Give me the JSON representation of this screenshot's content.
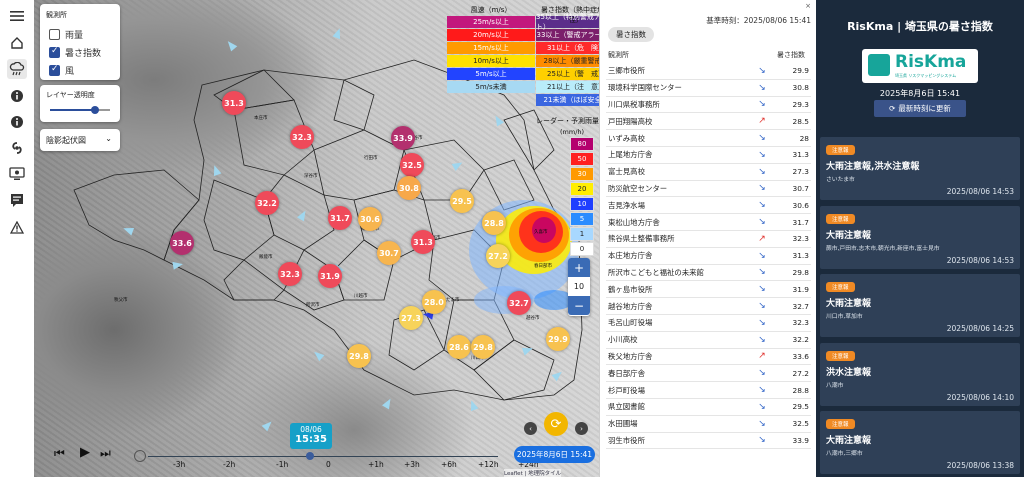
{
  "left_toolbar": [
    {
      "icon": "menu-icon"
    },
    {
      "icon": "home-icon"
    },
    {
      "icon": "rain-cloud-icon"
    },
    {
      "icon": "info-icon"
    },
    {
      "icon": "info-icon"
    },
    {
      "icon": "typhoon-icon"
    },
    {
      "icon": "monitor-icon"
    },
    {
      "icon": "bulletin-icon"
    },
    {
      "icon": "warning-icon"
    }
  ],
  "layers": {
    "title": "観測所",
    "items": [
      {
        "label": "雨量",
        "checked": false
      },
      {
        "label": "暑さ指数",
        "checked": true
      },
      {
        "label": "風",
        "checked": true
      }
    ]
  },
  "opacity": {
    "label": "レイヤー透明度",
    "value": 0.75
  },
  "basemap": {
    "selected": "陰影起伏図"
  },
  "legend_wind": {
    "title": "風速（m/s）",
    "rows": [
      {
        "label": "25m/s以上",
        "color": "#c2187d"
      },
      {
        "label": "20m/s以上",
        "color": "#ff1a1a"
      },
      {
        "label": "15m/s以上",
        "color": "#ff9a00"
      },
      {
        "label": "10m/s以上",
        "color": "#ffe100"
      },
      {
        "label": "5m/s以上",
        "color": "#2244ff"
      },
      {
        "label": "5m/s未満",
        "color": "#a7d9f3"
      }
    ]
  },
  "legend_wbgt": {
    "title": "暑さ指数（熱中症危険性）",
    "rows": [
      {
        "label": "35以上（特別警戒アラート）",
        "color": "#5b2d8a"
      },
      {
        "label": "33以上（警戒アラート）",
        "color": "#7b1f6b"
      },
      {
        "label": "31以上（危　険）",
        "color": "#ff2a2a"
      },
      {
        "label": "28以上（厳重警戒）",
        "color": "#ff8c00"
      },
      {
        "label": "25以上（警　戒）",
        "color": "#ffd000"
      },
      {
        "label": "21以上（注　意）",
        "color": "#b9ecfa"
      },
      {
        "label": "21未満（ほぼ安全）",
        "color": "#3a66e0"
      }
    ]
  },
  "legend_rain": {
    "title": "レーダー・予測雨量",
    "unit": "(mm/h)",
    "rows": [
      {
        "label": "80",
        "color": "#b4006e"
      },
      {
        "label": "50",
        "color": "#ff2020"
      },
      {
        "label": "30",
        "color": "#ff9a00"
      },
      {
        "label": "20",
        "color": "#ffee00"
      },
      {
        "label": "10",
        "color": "#1f3fff"
      },
      {
        "label": "5",
        "color": "#2b8cff"
      },
      {
        "label": "1",
        "color": "#a8d8ff"
      },
      {
        "label": "0",
        "color": "#ffffff"
      }
    ]
  },
  "markers": [
    {
      "v": "31.3",
      "c": "#ef4a5a"
    },
    {
      "v": "32.3",
      "c": "#ef4a5a"
    },
    {
      "v": "33.9",
      "c": "#b3306e"
    },
    {
      "v": "32.5",
      "c": "#ef4a5a"
    },
    {
      "v": "30.8",
      "c": "#f7a84a"
    },
    {
      "v": "32.2",
      "c": "#ef4a5a"
    },
    {
      "v": "31.7",
      "c": "#ef4a5a"
    },
    {
      "v": "30.6",
      "c": "#f7b54f"
    },
    {
      "v": "29.5",
      "c": "#f7c24f"
    },
    {
      "v": "28.8",
      "c": "#f7c24f"
    },
    {
      "v": "33.6",
      "c": "#b3306e"
    },
    {
      "v": "31.3",
      "c": "#ef4a5a"
    },
    {
      "v": "30.7",
      "c": "#f7b54f"
    },
    {
      "v": "27.2",
      "c": "#f7d35a"
    },
    {
      "v": "32.3",
      "c": "#ef4a5a"
    },
    {
      "v": "31.9",
      "c": "#ef4a5a"
    },
    {
      "v": "28.0",
      "c": "#f7c24f"
    },
    {
      "v": "27.3",
      "c": "#f7d35a"
    },
    {
      "v": "32.7",
      "c": "#ef4a5a"
    },
    {
      "v": "28.6",
      "c": "#f7c24f"
    },
    {
      "v": "29.8",
      "c": "#f7c24f"
    },
    {
      "v": "29.8",
      "c": "#f7c24f"
    },
    {
      "v": "29.9",
      "c": "#f7c24f"
    }
  ],
  "cities": [
    "秩父市",
    "熊谷市",
    "深谷市",
    "本庄市",
    "行田市",
    "東松山市",
    "川越市",
    "所沢市",
    "川口市",
    "越谷市",
    "春日部市",
    "さいたま市",
    "飯能市",
    "久喜市",
    "鴻巣市",
    "上尾市"
  ],
  "timeline": {
    "labels": [
      "-3h",
      "-2h",
      "-1h",
      "0",
      "+1h",
      "+3h",
      "+6h",
      "+12h",
      "+24h"
    ],
    "badge_date": "08/06",
    "badge_time": "15:35",
    "date_button": "2025年8月6日 15:41",
    "attribution": "Leaflet | 地理院タイル"
  },
  "zoom": {
    "plus": "+",
    "level": "10",
    "minus": "−"
  },
  "list": {
    "timestamp": "基準時刻：2025/08/06 15:41",
    "tab": "暑さ指数",
    "col_name": "観測所",
    "col_value": "暑さ指数",
    "rows": [
      {
        "name": "三郷市役所",
        "trend": "↘",
        "value": "29.9"
      },
      {
        "name": "環境科学国際センター",
        "trend": "↘",
        "value": "30.8"
      },
      {
        "name": "川口県税事務所",
        "trend": "↘",
        "value": "29.3"
      },
      {
        "name": "戸田翔陽高校",
        "trend": "↗",
        "value": "28.5"
      },
      {
        "name": "いずみ高校",
        "trend": "↘",
        "value": "28"
      },
      {
        "name": "上尾地方庁舎",
        "trend": "↘",
        "value": "31.3"
      },
      {
        "name": "富士見高校",
        "trend": "↘",
        "value": "27.3"
      },
      {
        "name": "防災航空センター",
        "trend": "↘",
        "value": "30.7"
      },
      {
        "name": "吉見浄水場",
        "trend": "↘",
        "value": "30.6"
      },
      {
        "name": "東松山地方庁舎",
        "trend": "↘",
        "value": "31.7"
      },
      {
        "name": "熊谷県土整備事務所",
        "trend": "↗",
        "value": "32.3"
      },
      {
        "name": "本庄地方庁舎",
        "trend": "↘",
        "value": "31.3"
      },
      {
        "name": "所沢市こどもと福祉の未来館",
        "trend": "↘",
        "value": "29.8"
      },
      {
        "name": "鶴ヶ島市役所",
        "trend": "↘",
        "value": "31.9"
      },
      {
        "name": "越谷地方庁舎",
        "trend": "↘",
        "value": "32.7"
      },
      {
        "name": "毛呂山町役場",
        "trend": "↘",
        "value": "32.3"
      },
      {
        "name": "小川高校",
        "trend": "↘",
        "value": "32.2"
      },
      {
        "name": "秩父地方庁舎",
        "trend": "↗",
        "value": "33.6"
      },
      {
        "name": "春日部庁舎",
        "trend": "↘",
        "value": "27.2"
      },
      {
        "name": "杉戸町役場",
        "trend": "↘",
        "value": "28.8"
      },
      {
        "name": "県立図書館",
        "trend": "↘",
        "value": "29.5"
      },
      {
        "name": "水田圃場",
        "trend": "↘",
        "value": "32.5"
      },
      {
        "name": "羽生市役所",
        "trend": "↘",
        "value": "33.9"
      }
    ]
  },
  "side": {
    "title": "RisKma | 埼玉県の暑さ指数",
    "logo_text": "RisKma",
    "logo_sub": "埼玉県 リスクマッピングシステム",
    "date": "2025年8月6日 15:41",
    "refresh": "最新時刻に更新",
    "cards": [
      {
        "badge": "注意報",
        "title": "大雨注意報,洪水注意報",
        "cities": "さいたま市",
        "time": "2025/08/06 14:53"
      },
      {
        "badge": "注意報",
        "title": "大雨注意報",
        "cities": "蕨市,戸田市,志木市,朝光市,新座市,富士見市",
        "time": "2025/08/06 14:53"
      },
      {
        "badge": "注意報",
        "title": "大雨注意報",
        "cities": "川口市,草加市",
        "time": "2025/08/06 14:25"
      },
      {
        "badge": "注意報",
        "title": "洪水注意報",
        "cities": "八潮市",
        "time": "2025/08/06 14:10"
      },
      {
        "badge": "注意報",
        "title": "大雨注意報",
        "cities": "八潮市,三郷市",
        "time": "2025/08/06 13:38"
      }
    ]
  }
}
